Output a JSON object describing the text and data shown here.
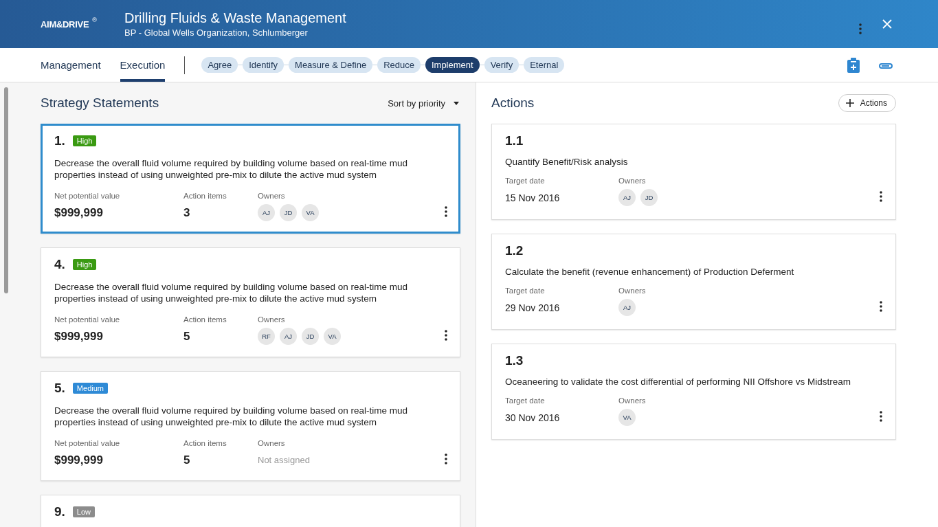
{
  "header": {
    "brand": "AIM&DRIVE",
    "brand_mark": "®",
    "title": "Drilling Fluids & Waste Management",
    "subtitle": "BP - Global Wells Organization, Schlumberger"
  },
  "tabs": [
    {
      "label": "Management",
      "selected": false
    },
    {
      "label": "Execution",
      "selected": true
    }
  ],
  "stages": [
    {
      "label": "Agree",
      "selected": false
    },
    {
      "label": "Identify",
      "selected": false
    },
    {
      "label": "Measure & Define",
      "selected": false
    },
    {
      "label": "Reduce",
      "selected": false
    },
    {
      "label": "Implement",
      "selected": true
    },
    {
      "label": "Verify",
      "selected": false
    },
    {
      "label": "Eternal",
      "selected": false
    }
  ],
  "strategy": {
    "title": "Strategy Statements",
    "sort": "Sort by priority",
    "cards": [
      {
        "number": "1.",
        "priority": "High",
        "color": "#3a9a12",
        "selected": true,
        "text": "Decrease the overall fluid volume required by building volume based on real-time mud properties instead of using unweighted pre-mix to dilute the active mud system",
        "value_label": "Net potential value",
        "value": "$999,999",
        "items_label": "Action items",
        "items": "3",
        "owners_label": "Owners",
        "owners": [
          "AJ",
          "JD",
          "VA"
        ]
      },
      {
        "number": "4.",
        "priority": "High",
        "color": "#3a9a12",
        "selected": false,
        "text": "Decrease the overall fluid volume required by building volume based on real-time mud properties instead of using unweighted pre-mix to dilute the active mud system",
        "value_label": "Net potential value",
        "value": "$999,999",
        "items_label": "Action items",
        "items": "5",
        "owners_label": "Owners",
        "owners": [
          "RF",
          "AJ",
          "JD",
          "VA"
        ]
      },
      {
        "number": "5.",
        "priority": "Medium",
        "color": "#2e8ad6",
        "selected": false,
        "text": "Decrease the overall fluid volume required by building volume based on real-time mud properties instead of using unweighted pre-mix to dilute the active mud system",
        "value_label": "Net potential value",
        "value": "$999,999",
        "items_label": "Action items",
        "items": "5",
        "owners_label": "Owners",
        "owners_empty": "Not assigned"
      },
      {
        "number": "9.",
        "priority": "Low",
        "color": "#8c8c8c",
        "selected": false
      }
    ]
  },
  "actions": {
    "title": "Actions",
    "add_button": "Actions",
    "cards": [
      {
        "number": "1.1",
        "text": "Quantify Benefit/Risk analysis",
        "date_label": "Target date",
        "date": "15 Nov 2016",
        "owners_label": "Owners",
        "owners": [
          "AJ",
          "JD"
        ]
      },
      {
        "number": "1.2",
        "text": "Calculate the benefit (revenue enhancement) of Production Deferment",
        "date_label": "Target date",
        "date": "29 Nov 2016",
        "owners_label": "Owners",
        "owners": [
          "AJ"
        ]
      },
      {
        "number": "1.3",
        "text": "Oceaneering to validate the cost differential of performing NII Offshore vs Midstream",
        "date_label": "Target date",
        "date": "30 Nov 2016",
        "owners_label": "Owners",
        "owners": [
          "VA"
        ]
      }
    ]
  }
}
